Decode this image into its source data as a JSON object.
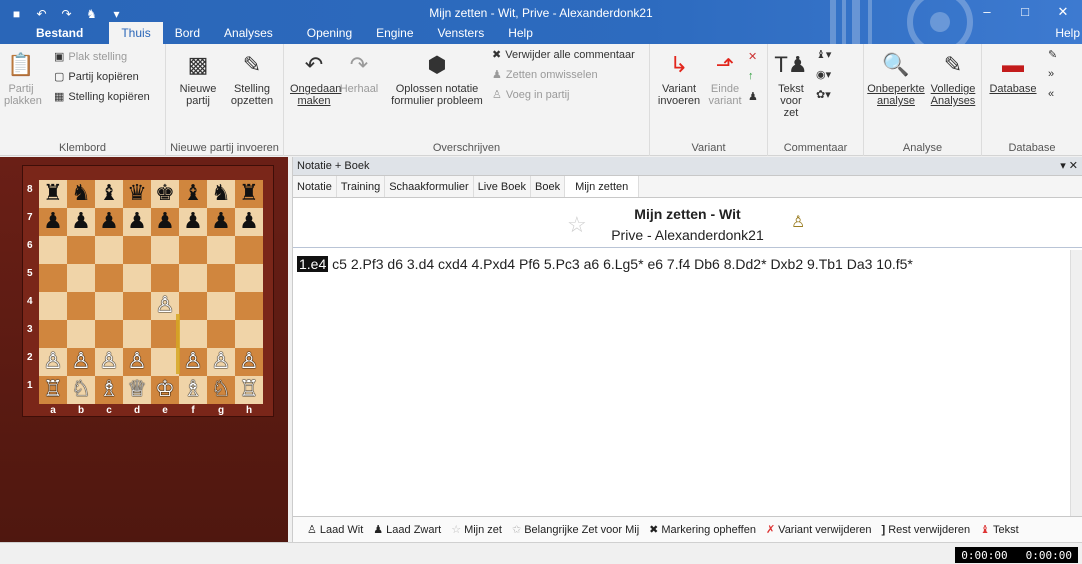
{
  "window": {
    "title": "Mijn zetten - Wit, Prive - Alexanderdonk21"
  },
  "tabs": [
    "Bestand",
    "Thuis",
    "Bord",
    "Analyses",
    "Opening",
    "Engine",
    "Vensters",
    "Help"
  ],
  "help_label": "Help",
  "ribbon": {
    "klembord": {
      "label": "Klembord",
      "paste": "Partij plakken",
      "paste_pos": "Plak stelling",
      "copy_game": "Partij kopiëren",
      "copy_pos": "Stelling kopiëren"
    },
    "nieuw": {
      "label": "Nieuwe partij invoeren",
      "new": "Nieuwe partij",
      "setup": "Stelling opzetten"
    },
    "over": {
      "label": "Overschrijven",
      "undo": "Ongedaan maken",
      "redo": "Herhaal",
      "solve": "Oplossen notatie formulier probleem",
      "del_comments": "Verwijder alle commentaar",
      "swap": "Zetten omwisselen",
      "insert": "Voeg in partij"
    },
    "variant": {
      "label": "Variant",
      "enter": "Variant invoeren",
      "end": "Einde variant"
    },
    "comment": {
      "label": "Commentaar",
      "text": "Tekst voor zet"
    },
    "analyse": {
      "label": "Analyse",
      "unlimited": "Onbeperkte analyse",
      "full": "Volledige Analyses"
    },
    "database": {
      "label": "Database",
      "db": "Database"
    }
  },
  "board": {
    "ranks": [
      "8",
      "7",
      "6",
      "5",
      "4",
      "3",
      "2",
      "1"
    ],
    "files": [
      "a",
      "b",
      "c",
      "d",
      "e",
      "f",
      "g",
      "h"
    ],
    "position": [
      [
        "♜",
        "♞",
        "♝",
        "♛",
        "♚",
        "♝",
        "♞",
        "♜"
      ],
      [
        "♟",
        "♟",
        "♟",
        "♟",
        "♟",
        "♟",
        "♟",
        "♟"
      ],
      [
        "",
        "",
        "",
        "",
        "",
        "",
        "",
        ""
      ],
      [
        "",
        "",
        "",
        "",
        "",
        "",
        "",
        ""
      ],
      [
        "",
        "",
        "",
        "",
        "♙",
        "",
        "",
        ""
      ],
      [
        "",
        "",
        "",
        "",
        "",
        "",
        "",
        ""
      ],
      [
        "♙",
        "♙",
        "♙",
        "♙",
        "",
        "♙",
        "♙",
        "♙"
      ],
      [
        "♖",
        "♘",
        "♗",
        "♕",
        "♔",
        "♗",
        "♘",
        "♖"
      ]
    ]
  },
  "panel": {
    "title": "Notatie + Boek",
    "tabs": [
      "Notatie",
      "Training",
      "Schaakformulier",
      "Live Boek",
      "Boek",
      "Mijn zetten"
    ]
  },
  "game": {
    "title": "Mijn zetten - Wit",
    "subtitle": "Prive - Alexanderdonk21"
  },
  "moves": [
    "1.e4",
    "c5",
    "2.Pf3",
    "d6",
    "3.d4",
    "cxd4",
    "4.Pxd4",
    "Pf6",
    "5.Pc3",
    "a6",
    "6.Lg5*",
    "e6",
    "7.f4",
    "Db6",
    "8.Dd2*",
    "Dxb2",
    "9.Tb1",
    "Da3",
    "10.f5*"
  ],
  "bottom_bar": [
    "Laad Wit",
    "Laad Zwart",
    "Mijn zet",
    "Belangrijke Zet voor Mij",
    "Markering opheffen",
    "Variant verwijderen",
    "Rest verwijderen",
    "Tekst"
  ],
  "clocks": [
    "0:00:00",
    "0:00:00"
  ]
}
